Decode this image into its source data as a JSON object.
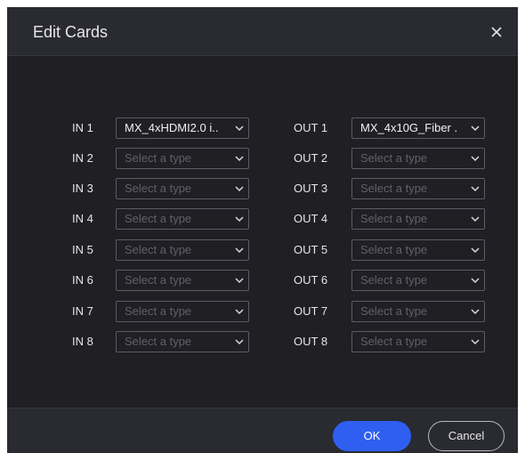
{
  "dialog": {
    "title": "Edit Cards"
  },
  "inputs": [
    {
      "label": "IN 1",
      "value": "MX_4xHDMI2.0 i..",
      "placeholder": "Select a type"
    },
    {
      "label": "IN 2",
      "value": "",
      "placeholder": "Select a type"
    },
    {
      "label": "IN 3",
      "value": "",
      "placeholder": "Select a type"
    },
    {
      "label": "IN 4",
      "value": "",
      "placeholder": "Select a type"
    },
    {
      "label": "IN 5",
      "value": "",
      "placeholder": "Select a type"
    },
    {
      "label": "IN 6",
      "value": "",
      "placeholder": "Select a type"
    },
    {
      "label": "IN 7",
      "value": "",
      "placeholder": "Select a type"
    },
    {
      "label": "IN 8",
      "value": "",
      "placeholder": "Select a type"
    }
  ],
  "outputs": [
    {
      "label": "OUT 1",
      "value": "MX_4x10G_Fiber .",
      "placeholder": "Select a type"
    },
    {
      "label": "OUT 2",
      "value": "",
      "placeholder": "Select a type"
    },
    {
      "label": "OUT 3",
      "value": "",
      "placeholder": "Select a type"
    },
    {
      "label": "OUT 4",
      "value": "",
      "placeholder": "Select a type"
    },
    {
      "label": "OUT 5",
      "value": "",
      "placeholder": "Select a type"
    },
    {
      "label": "OUT 6",
      "value": "",
      "placeholder": "Select a type"
    },
    {
      "label": "OUT 7",
      "value": "",
      "placeholder": "Select a type"
    },
    {
      "label": "OUT 8",
      "value": "",
      "placeholder": "Select a type"
    }
  ],
  "footer": {
    "ok_label": "OK",
    "cancel_label": "Cancel"
  },
  "icons": {
    "close": "close-icon",
    "dropdown": "chevron-down-icon"
  },
  "colors": {
    "dialog_background": "#1f1f24",
    "header_background": "#2a2b31",
    "primary_button": "#2f5ff0",
    "select_border": "#5a5c66",
    "placeholder_text": "#5f616c"
  }
}
